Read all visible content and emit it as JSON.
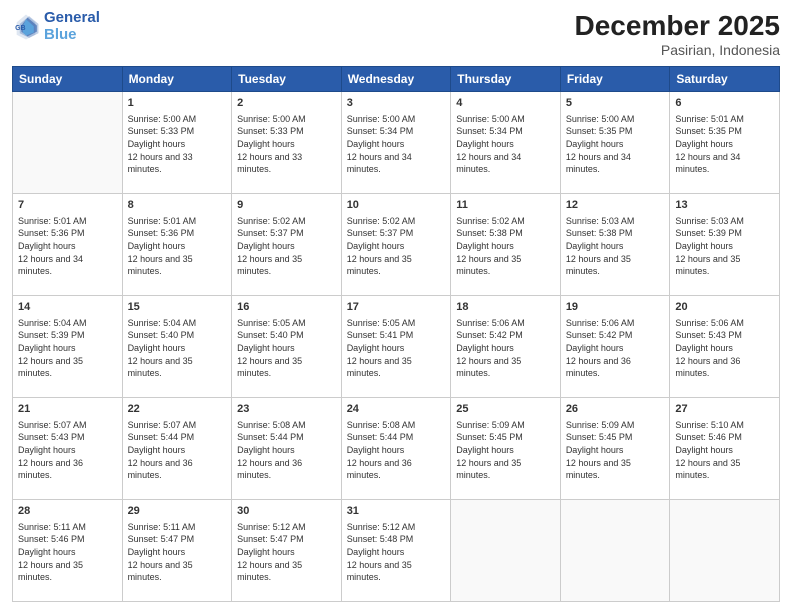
{
  "header": {
    "logo_line1": "General",
    "logo_line2": "Blue",
    "main_title": "December 2025",
    "subtitle": "Pasirian, Indonesia"
  },
  "weekdays": [
    "Sunday",
    "Monday",
    "Tuesday",
    "Wednesday",
    "Thursday",
    "Friday",
    "Saturday"
  ],
  "weeks": [
    [
      {
        "day": "",
        "sunrise": "",
        "sunset": "",
        "daylight": ""
      },
      {
        "day": "1",
        "sunrise": "5:00 AM",
        "sunset": "5:33 PM",
        "daylight": "12 hours and 33 minutes."
      },
      {
        "day": "2",
        "sunrise": "5:00 AM",
        "sunset": "5:33 PM",
        "daylight": "12 hours and 33 minutes."
      },
      {
        "day": "3",
        "sunrise": "5:00 AM",
        "sunset": "5:34 PM",
        "daylight": "12 hours and 34 minutes."
      },
      {
        "day": "4",
        "sunrise": "5:00 AM",
        "sunset": "5:34 PM",
        "daylight": "12 hours and 34 minutes."
      },
      {
        "day": "5",
        "sunrise": "5:00 AM",
        "sunset": "5:35 PM",
        "daylight": "12 hours and 34 minutes."
      },
      {
        "day": "6",
        "sunrise": "5:01 AM",
        "sunset": "5:35 PM",
        "daylight": "12 hours and 34 minutes."
      }
    ],
    [
      {
        "day": "7",
        "sunrise": "5:01 AM",
        "sunset": "5:36 PM",
        "daylight": "12 hours and 34 minutes."
      },
      {
        "day": "8",
        "sunrise": "5:01 AM",
        "sunset": "5:36 PM",
        "daylight": "12 hours and 35 minutes."
      },
      {
        "day": "9",
        "sunrise": "5:02 AM",
        "sunset": "5:37 PM",
        "daylight": "12 hours and 35 minutes."
      },
      {
        "day": "10",
        "sunrise": "5:02 AM",
        "sunset": "5:37 PM",
        "daylight": "12 hours and 35 minutes."
      },
      {
        "day": "11",
        "sunrise": "5:02 AM",
        "sunset": "5:38 PM",
        "daylight": "12 hours and 35 minutes."
      },
      {
        "day": "12",
        "sunrise": "5:03 AM",
        "sunset": "5:38 PM",
        "daylight": "12 hours and 35 minutes."
      },
      {
        "day": "13",
        "sunrise": "5:03 AM",
        "sunset": "5:39 PM",
        "daylight": "12 hours and 35 minutes."
      }
    ],
    [
      {
        "day": "14",
        "sunrise": "5:04 AM",
        "sunset": "5:39 PM",
        "daylight": "12 hours and 35 minutes."
      },
      {
        "day": "15",
        "sunrise": "5:04 AM",
        "sunset": "5:40 PM",
        "daylight": "12 hours and 35 minutes."
      },
      {
        "day": "16",
        "sunrise": "5:05 AM",
        "sunset": "5:40 PM",
        "daylight": "12 hours and 35 minutes."
      },
      {
        "day": "17",
        "sunrise": "5:05 AM",
        "sunset": "5:41 PM",
        "daylight": "12 hours and 35 minutes."
      },
      {
        "day": "18",
        "sunrise": "5:06 AM",
        "sunset": "5:42 PM",
        "daylight": "12 hours and 35 minutes."
      },
      {
        "day": "19",
        "sunrise": "5:06 AM",
        "sunset": "5:42 PM",
        "daylight": "12 hours and 36 minutes."
      },
      {
        "day": "20",
        "sunrise": "5:06 AM",
        "sunset": "5:43 PM",
        "daylight": "12 hours and 36 minutes."
      }
    ],
    [
      {
        "day": "21",
        "sunrise": "5:07 AM",
        "sunset": "5:43 PM",
        "daylight": "12 hours and 36 minutes."
      },
      {
        "day": "22",
        "sunrise": "5:07 AM",
        "sunset": "5:44 PM",
        "daylight": "12 hours and 36 minutes."
      },
      {
        "day": "23",
        "sunrise": "5:08 AM",
        "sunset": "5:44 PM",
        "daylight": "12 hours and 36 minutes."
      },
      {
        "day": "24",
        "sunrise": "5:08 AM",
        "sunset": "5:44 PM",
        "daylight": "12 hours and 36 minutes."
      },
      {
        "day": "25",
        "sunrise": "5:09 AM",
        "sunset": "5:45 PM",
        "daylight": "12 hours and 35 minutes."
      },
      {
        "day": "26",
        "sunrise": "5:09 AM",
        "sunset": "5:45 PM",
        "daylight": "12 hours and 35 minutes."
      },
      {
        "day": "27",
        "sunrise": "5:10 AM",
        "sunset": "5:46 PM",
        "daylight": "12 hours and 35 minutes."
      }
    ],
    [
      {
        "day": "28",
        "sunrise": "5:11 AM",
        "sunset": "5:46 PM",
        "daylight": "12 hours and 35 minutes."
      },
      {
        "day": "29",
        "sunrise": "5:11 AM",
        "sunset": "5:47 PM",
        "daylight": "12 hours and 35 minutes."
      },
      {
        "day": "30",
        "sunrise": "5:12 AM",
        "sunset": "5:47 PM",
        "daylight": "12 hours and 35 minutes."
      },
      {
        "day": "31",
        "sunrise": "5:12 AM",
        "sunset": "5:48 PM",
        "daylight": "12 hours and 35 minutes."
      },
      {
        "day": "",
        "sunrise": "",
        "sunset": "",
        "daylight": ""
      },
      {
        "day": "",
        "sunrise": "",
        "sunset": "",
        "daylight": ""
      },
      {
        "day": "",
        "sunrise": "",
        "sunset": "",
        "daylight": ""
      }
    ]
  ]
}
